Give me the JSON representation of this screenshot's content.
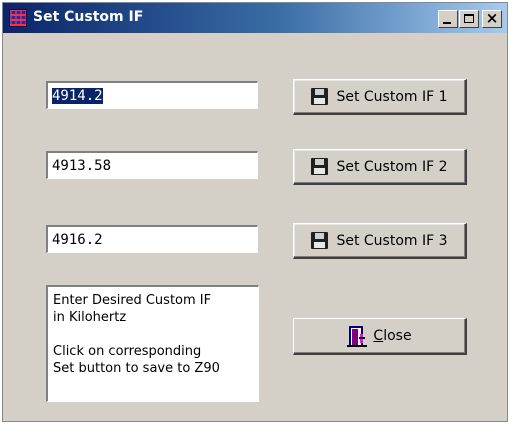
{
  "window": {
    "title": "Set Custom IF",
    "icon": "grid-app-icon",
    "controls": {
      "minimize": "minimize-icon",
      "maximize": "maximize-icon",
      "close": "×"
    }
  },
  "fields": [
    {
      "value": "4914.2",
      "selected": true
    },
    {
      "value": "4913.58",
      "selected": false
    },
    {
      "value": "4916.2",
      "selected": false
    }
  ],
  "buttons": [
    {
      "label": "Set Custom IF 1",
      "icon": "floppy-disk-icon"
    },
    {
      "label": "Set Custom IF 2",
      "icon": "floppy-disk-icon"
    },
    {
      "label": "Set Custom IF 3",
      "icon": "floppy-disk-icon"
    }
  ],
  "info": {
    "line1": "Enter Desired Custom IF\nin Kilohertz",
    "line2": "Click on corresponding\nSet button to save to Z90"
  },
  "close_button": {
    "mnemonic": "C",
    "rest": "lose",
    "icon": "exit-door-icon"
  },
  "colors": {
    "face": "#d4d0c8",
    "title_start": "#0a246a",
    "title_end": "#a6caf0",
    "selection": "#0a246a"
  }
}
